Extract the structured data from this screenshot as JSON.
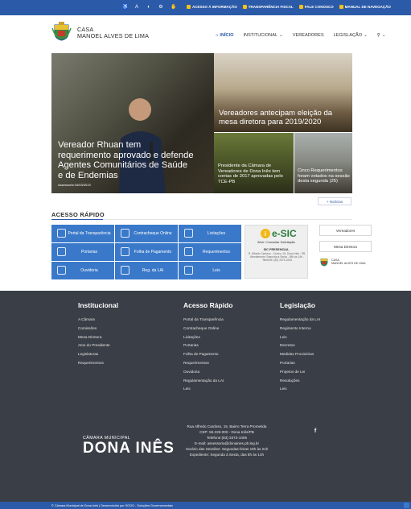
{
  "topbar": {
    "icons": [
      "accessibility-icon",
      "font-increase-icon",
      "contrast-icon",
      "gear-icon",
      "sign-language-icon"
    ],
    "links": [
      {
        "label": "ACESSO À INFORMAÇÃO"
      },
      {
        "label": "TRANSPARÊNCIA FISCAL"
      },
      {
        "label": "FALE CONOSCO"
      },
      {
        "label": "MANUAL DE NAVEGAÇÃO"
      }
    ]
  },
  "brand": {
    "line1": "CASA",
    "line2": "MANOEL ALVES DE LIMA"
  },
  "nav": {
    "items": [
      {
        "label": "INÍCIO",
        "active": true
      },
      {
        "label": "INSTITUCIONAL",
        "dropdown": true
      },
      {
        "label": "VEREADORES"
      },
      {
        "label": "LEGISLAÇÃO",
        "dropdown": true
      }
    ],
    "search_icon": "search-icon"
  },
  "featured": {
    "main": {
      "title": "Vereador Rhuan tem requerimento aprovado e defende Agentes Comunitários de Saúde e de Endemias",
      "meta": "Assessoria  04/03/2019"
    },
    "tile1": "Vereadores antecipam eleição da mesa diretora para 2019/2020",
    "tile2": "Presidente da Câmara de Vereadores de Dona Inês tem contas de 2017 aprovadas pelo TCE-PB",
    "tile3": "Cinco Requerimentos foram votados na sessão desta segunda (25)",
    "more": "+ Notícias"
  },
  "quick_access": {
    "title": "ACESSO RÁPIDO",
    "items": [
      {
        "label": "Portal da Transparência",
        "icon": "search-icon"
      },
      {
        "label": "Contracheque Online",
        "icon": "payslip-icon"
      },
      {
        "label": "Licitações",
        "icon": "gavel-icon"
      },
      {
        "label": "Portarias",
        "icon": "document-icon"
      },
      {
        "label": "Folha de Pagamento",
        "icon": "payroll-icon"
      },
      {
        "label": "Requerimentos",
        "icon": "document-icon"
      },
      {
        "label": "Ouvidoria",
        "icon": "headset-icon"
      },
      {
        "label": "Reg. da LAI",
        "icon": "document-icon"
      },
      {
        "label": "Leis",
        "icon": "law-icon"
      }
    ],
    "esic": {
      "logo_text": "e-SIC",
      "subtitle": "Abrir / Consultar Solicitação",
      "presencial": "SIC PRESENCIAL",
      "address": "R. Alfredo Cardoso - Centro, 15, Dona Inês - PB. Atendimento: Segunda à Sexta - 08h às 14h - Telefone: (83) 3373-1005"
    },
    "side_buttons": [
      "Vereadores",
      "Mesa Diretora"
    ],
    "side_logo": {
      "line1": "CASA",
      "line2": "MANOEL ALVES DE LIMA"
    }
  },
  "footer": {
    "col1": {
      "title": "Institucional",
      "items": [
        "A Câmara",
        "Comissões",
        "Mesa Diretora",
        "Atos do Presidente",
        "Legislaturas",
        "Requerimentos"
      ]
    },
    "col2": {
      "title": "Acesso Rápido",
      "items": [
        "Portal da Transparência",
        "Contracheque Online",
        "Licitações",
        "Portarias",
        "Folha de Pagamento",
        "Requerimentos",
        "Ouvidoria",
        "Regulamentação da LAI",
        "Leis"
      ]
    },
    "col3": {
      "title": "Legislação",
      "items": [
        "Regulamentação da LAI",
        "Regimento Interno",
        "Leis",
        "Decretos",
        "Medidas Provisórias",
        "Portarias",
        "Projetos de Lei",
        "Resoluções",
        "Leis"
      ]
    },
    "logo": {
      "small": "CÂMARA MUNICIPAL",
      "big": "DONA INÊS"
    },
    "contact": {
      "address": "Rua Alfredo Cardoso, 15, Bairro Terra Prometida",
      "cep": "CEP: 58.228-000 - Dona Inês/PB",
      "phone": "Telefone:(83) 3373-1005",
      "email": "E-mail: assessoria@donaines.pb.leg.br",
      "sessions": "Horário das Sessões: Segundas-feiras 19h às 21h",
      "hours": "Expediente: Segunda à Sexta, das 8h às 14h"
    },
    "social_icon": "facebook-icon"
  },
  "bottombar": {
    "text": "© Câmara Municipal de Dona Inês | Desenvolvido por SOGO - Soluções Governamentais"
  },
  "colors": {
    "primary": "#2b5aa8",
    "tile": "#3a79c9",
    "footer": "#3a3e46",
    "accent": "#f5c21a"
  }
}
